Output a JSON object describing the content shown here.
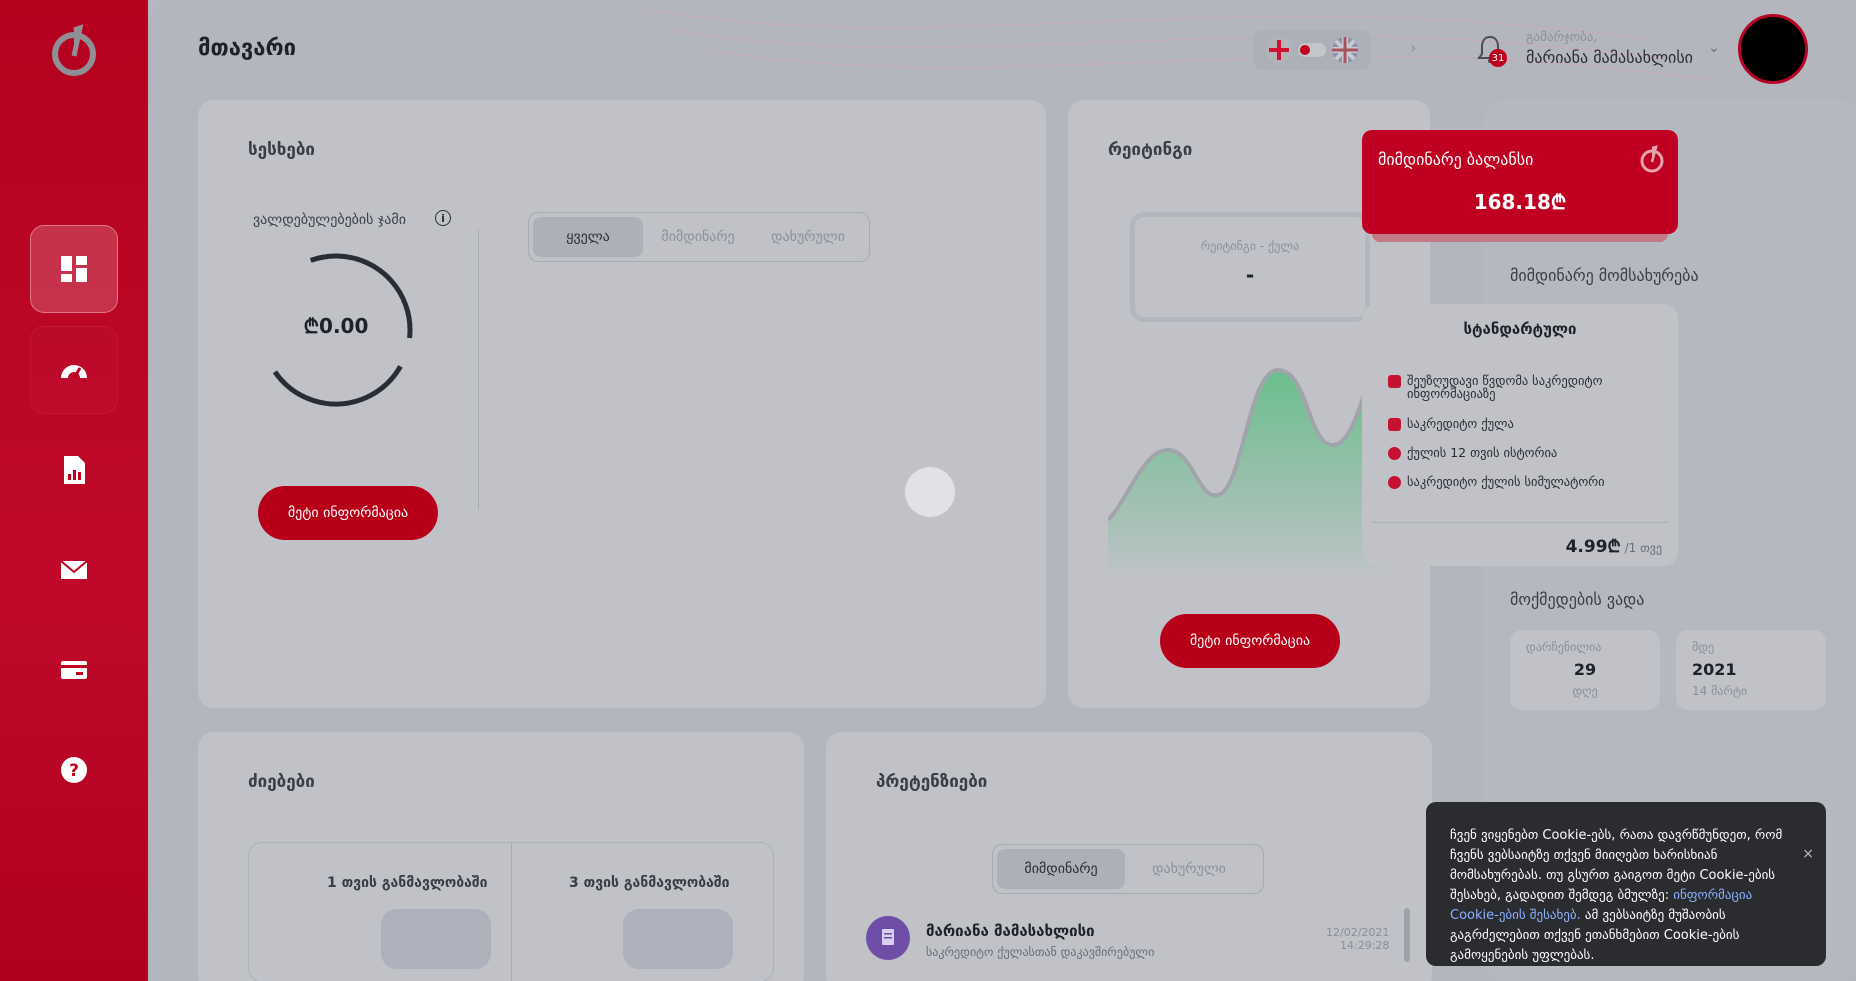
{
  "header": {
    "title": "მთავარი",
    "greeting": "გამარჯობა,",
    "username": "მარიანა მამასახლისი",
    "notification_count": "31"
  },
  "sidebar": {
    "items": [
      {
        "name": "dashboard",
        "active": true
      },
      {
        "name": "rating"
      },
      {
        "name": "reports"
      },
      {
        "name": "messages"
      },
      {
        "name": "payments"
      },
      {
        "name": "help"
      }
    ]
  },
  "sessions": {
    "title": "სესხები",
    "obligations_label": "ვალდებულებების ჯამი",
    "amount": "₾0.00",
    "more_button": "მეტი ინფორმაცია",
    "tabs": [
      "ყველა",
      "მიმდინარე",
      "დახურული"
    ],
    "active_tab": "ყველა"
  },
  "rating": {
    "title": "რეიტინგი",
    "box_label": "რეიტინგი - ქულა",
    "box_value": "-",
    "more_button": "მეტი ინფორმაცია"
  },
  "balance": {
    "title": "მიმდინარე ბალანსი",
    "value": "168.18₾"
  },
  "service": {
    "section_title": "მიმდინარე მომსახურება",
    "plan_name": "სტანდარტული",
    "features": [
      "შეუზღუდავი წვდომა საკრედიტო ინფორმაციაზე",
      "საკრედიტო ქულა",
      "ქულის 12 თვის ისტორია",
      "საკრედიტო ქულის სიმულატორი"
    ],
    "price": "4.99₾",
    "period": "/1 თვე"
  },
  "validity": {
    "section_title": "მოქმედების ვადა",
    "remaining_label": "დარჩენილია",
    "remaining_value": "29",
    "remaining_unit": "დღე",
    "until_label": "მდე",
    "until_year": "2021",
    "until_date": "14 მარტი"
  },
  "searches": {
    "title": "ძიებები",
    "periods": [
      "1 თვის განმავლობაში",
      "3 თვის განმავლობაში"
    ]
  },
  "claims": {
    "title": "პრეტენზიები",
    "tabs": [
      "მიმდინარე",
      "დახურული"
    ],
    "active_tab": "მიმდინარე",
    "items": [
      {
        "name": "მარიანა მამასახლისი",
        "desc": "საკრედიტო ქულასთან დაკავშირებული",
        "date": "12/02/2021",
        "time": "14:29:28"
      }
    ]
  },
  "cookie": {
    "text": "ჩვენ ვიყენებთ Cookie-ებს, რათა დავრწმუნდეთ, რომ ჩვენს ვებსაიტზე თქვენ მიიღებთ ხარისხიან მომსახურებას. თუ გსურთ გაიგოთ მეტი Cookie-ების შესახებ, გადადით შემდეგ ბმულზე:",
    "link": "ინფორმაცია Cookie-ების შესახებ.",
    "text2": "ამ ვებსაიტზე მუშაობის გაგრძელებით თქვენ ეთანხმებით Cookie-ების გამოყენების უფლებას.",
    "close": "×"
  },
  "colors": {
    "brand_red": "#c1001e",
    "chart_green": "#5fbe84"
  }
}
